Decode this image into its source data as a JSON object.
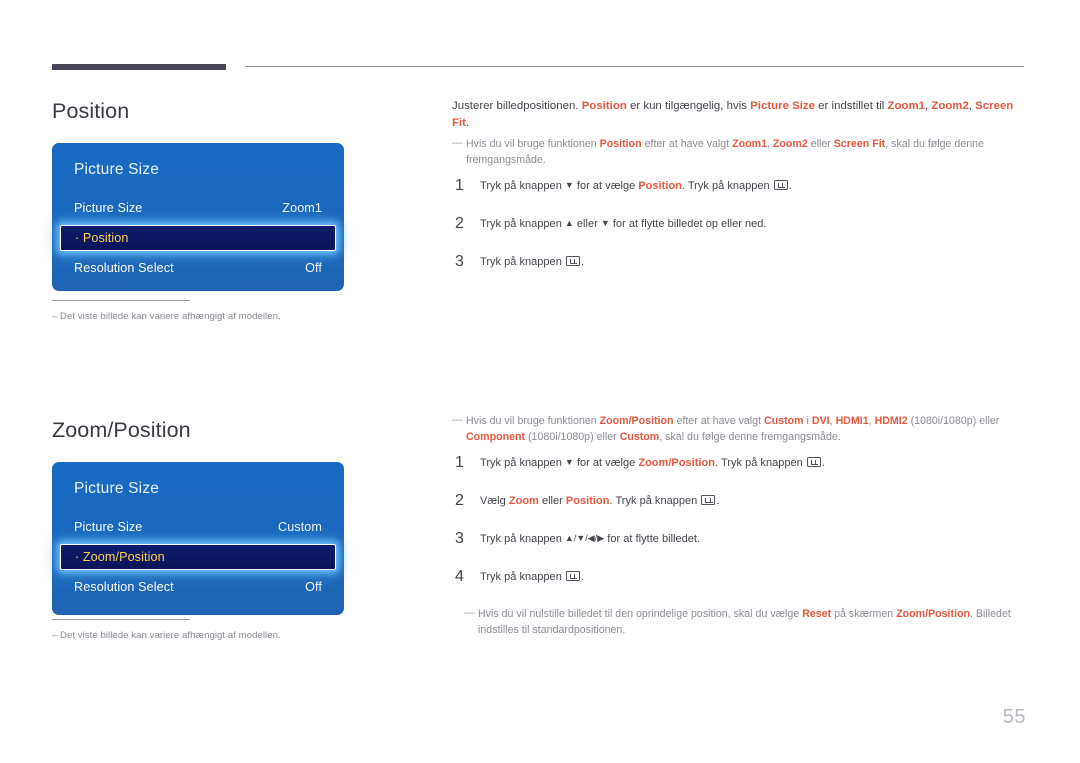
{
  "page": {
    "number": "55",
    "accent_color": "#e8573f",
    "panel_color": "#1b66bb",
    "highlight_color": "#0b1a63",
    "highlight_text_color": "#ffd24a"
  },
  "sections": [
    {
      "title": "Position",
      "panel": {
        "title": "Picture Size",
        "rows": [
          {
            "label": "Picture Size",
            "value": "Zoom1",
            "selected": false
          },
          {
            "label": "· Position",
            "value": "",
            "selected": true
          },
          {
            "label": "Resolution Select",
            "value": "Off",
            "selected": false
          }
        ]
      },
      "note": {
        "dash": "–",
        "text": "Det viste billede kan variere afhængigt af modellen."
      },
      "intro": {
        "p1": "Justerer billedpositionen. ",
        "a1": "Position",
        "p2": " er kun tilgængelig, hvis ",
        "a2": "Picture Size",
        "p3": " er indstillet til ",
        "a3": "Zoom1",
        "p4": ", ",
        "a4": "Zoom2",
        "p5": ", ",
        "a5": "Screen Fit",
        "p6": "."
      },
      "hint": {
        "p1": "Hvis du vil bruge funktionen ",
        "a1": "Position",
        "p2": " efter at have valgt ",
        "a2": "Zoom1",
        "p3": ", ",
        "a3": "Zoom2",
        "p4": " eller ",
        "a4": "Screen Fit",
        "p5": ", skal du følge denne fremgangsmåde."
      },
      "steps": [
        {
          "num": "1",
          "p1": "Tryk på knappen ",
          "arrow1": "▼",
          "p2": " for at vælge ",
          "a1": "Position",
          "p3": ". Tryk på knappen ",
          "key": "enter-key-icon",
          "p4": "."
        },
        {
          "num": "2",
          "p1": "Tryk på knappen ",
          "arrow1": "▲",
          "p2": " eller ",
          "arrow2": "▼",
          "p3": " for at flytte billedet op eller ned."
        },
        {
          "num": "3",
          "p1": "Tryk på knappen ",
          "key": "enter-key-icon",
          "p2": "."
        }
      ]
    },
    {
      "title": "Zoom/Position",
      "panel": {
        "title": "Picture Size",
        "rows": [
          {
            "label": "Picture Size",
            "value": "Custom",
            "selected": false
          },
          {
            "label": "· Zoom/Position",
            "value": "",
            "selected": true
          },
          {
            "label": "Resolution Select",
            "value": "Off",
            "selected": false
          }
        ]
      },
      "note": {
        "dash": "–",
        "text": "Det viste billede kan variere afhængigt af modellen."
      },
      "hint": {
        "p1": "Hvis du vil bruge funktionen ",
        "a1": "Zoom/Position",
        "p2": " efter at have valgt ",
        "a2": "Custom",
        "p3": " i ",
        "a3": "DVI",
        "p4": ", ",
        "a4": "HDMI1",
        "p5": ", ",
        "a5": "HDMI2",
        "p6": " (1080i/1080p) eller ",
        "a6": "Component",
        "p7": " (1080i/1080p) eller ",
        "a7": "Custom",
        "p8": ", skal du følge denne fremgangsmåde."
      },
      "steps": [
        {
          "num": "1",
          "p1": "Tryk på knappen ",
          "arrow1": "▼",
          "p2": " for at vælge ",
          "a1": "Zoom/Position",
          "p3": ". Tryk på knappen ",
          "key": "enter-key-icon",
          "p4": "."
        },
        {
          "num": "2",
          "p1": "Vælg ",
          "a1": "Zoom",
          "p2": " eller ",
          "a2": "Position",
          "p3": ". Tryk på knappen ",
          "key": "enter-key-icon",
          "p4": "."
        },
        {
          "num": "3",
          "p1": "Tryk på knappen ",
          "arrows": "▲/▼/◀/▶",
          "p2": " for at flytte billedet."
        },
        {
          "num": "4",
          "p1": "Tryk på knappen ",
          "key": "enter-key-icon",
          "p2": "."
        }
      ],
      "footer_hint": {
        "p1": "Hvis du vil nulstille billedet til den oprindelige position, skal du vælge ",
        "a1": "Reset",
        "p2": " på skærmen ",
        "a2": "Zoom/Position",
        "p3": ". Billedet indstilles til standardpositionen."
      }
    }
  ]
}
